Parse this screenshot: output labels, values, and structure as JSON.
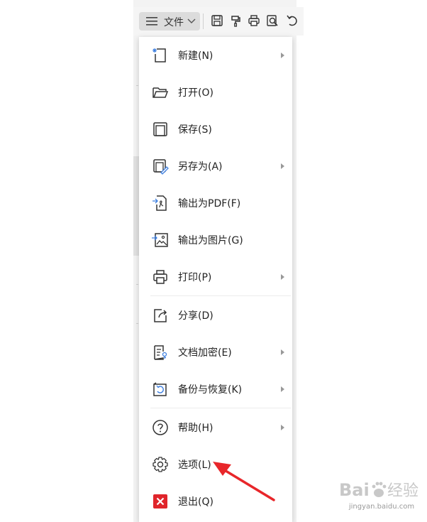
{
  "toolbar": {
    "file_label": "文件",
    "icons": [
      "save-icon",
      "format-painter-icon",
      "print-icon",
      "print-preview-icon",
      "undo-icon"
    ]
  },
  "menu": {
    "items": [
      {
        "label": "新建(N)",
        "icon": "new-document-icon",
        "submenu": true
      },
      {
        "label": "打开(O)",
        "icon": "folder-open-icon",
        "submenu": false
      },
      {
        "label": "保存(S)",
        "icon": "save-icon",
        "submenu": false
      },
      {
        "label": "另存为(A)",
        "icon": "save-as-icon",
        "submenu": true
      },
      {
        "label": "输出为PDF(F)",
        "icon": "export-pdf-icon",
        "submenu": false
      },
      {
        "label": "输出为图片(G)",
        "icon": "export-image-icon",
        "submenu": false
      },
      {
        "label": "打印(P)",
        "icon": "print-icon",
        "submenu": true
      },
      {
        "label": "分享(D)",
        "icon": "share-icon",
        "submenu": false
      },
      {
        "label": "文档加密(E)",
        "icon": "encrypt-icon",
        "submenu": true
      },
      {
        "label": "备份与恢复(K)",
        "icon": "backup-restore-icon",
        "submenu": true
      },
      {
        "label": "帮助(H)",
        "icon": "help-icon",
        "submenu": true
      },
      {
        "label": "选项(L)",
        "icon": "gear-icon",
        "submenu": false
      },
      {
        "label": "退出(Q)",
        "icon": "exit-icon",
        "submenu": false
      }
    ]
  },
  "colors": {
    "accent_exit": "#e0252b",
    "annotation_arrow": "#e8262a",
    "watermark": "#c8c8c8"
  },
  "watermark": {
    "url": "jingyan.baidu.com"
  }
}
